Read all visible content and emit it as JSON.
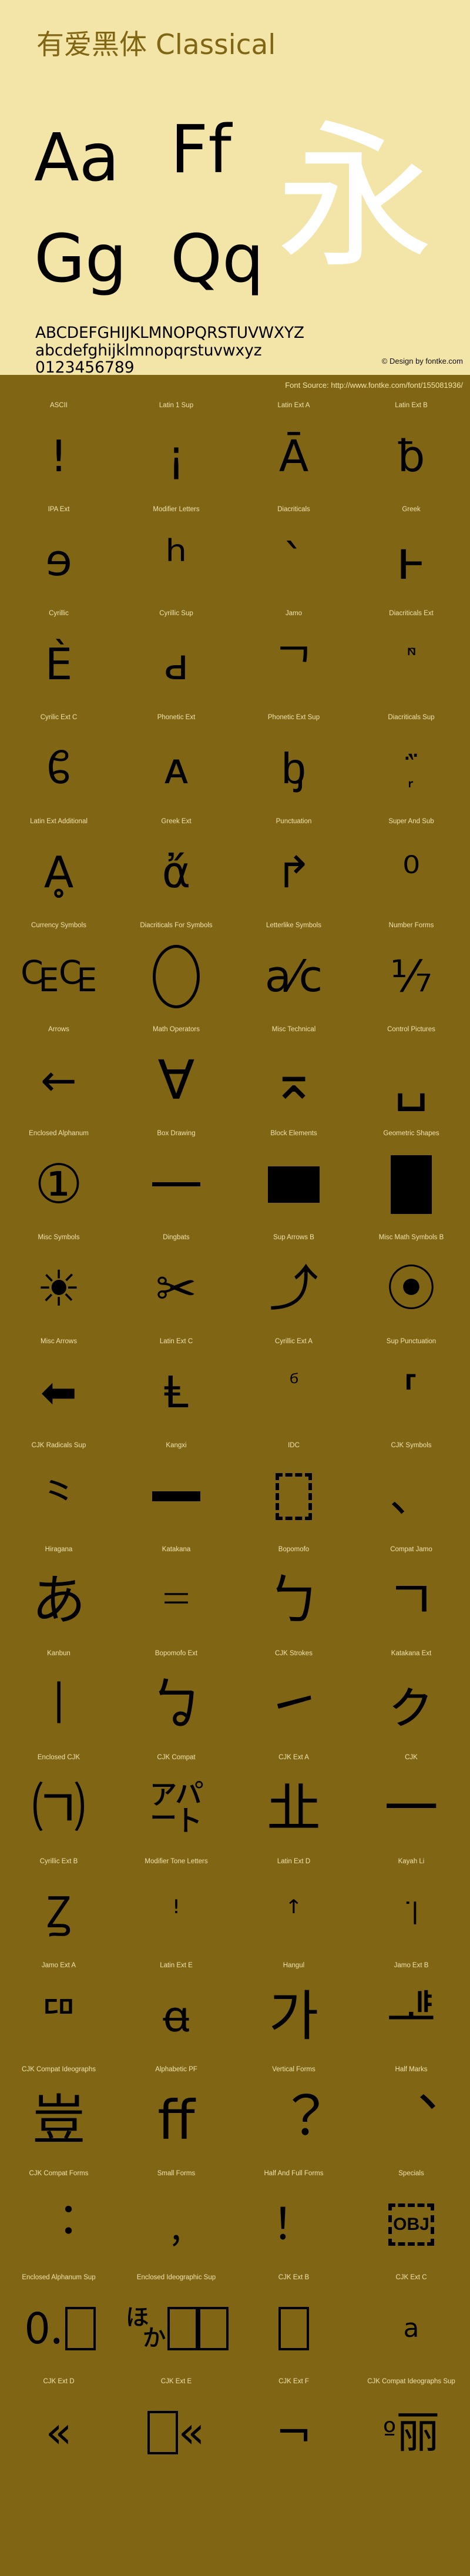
{
  "header": {
    "font_title": "有爱黑体 Classical",
    "samples": {
      "aa": "Aa",
      "ff": "Ff",
      "gg": "Gg",
      "qq": "Qq",
      "cjk": "永"
    },
    "alphabet_upper": "ABCDEFGHIJKLMNOPQRSTUVWXYZ",
    "alphabet_lower": "abcdefghijklmnopqrstuvwxyz",
    "digits": "0123456789",
    "credit": "© Design by fontke.com"
  },
  "source_bar": {
    "font_source": "Font Source: http://www.fontke.com/font/155081936/"
  },
  "colors": {
    "cream": "#F3E4A7",
    "olive": "#806614",
    "title": "#806614",
    "glyph": "#000000",
    "label": "#EFE2AE",
    "white_glyph": "#FFFFFF"
  },
  "glyph_grid": {
    "columns": 4,
    "rows": [
      [
        {
          "label": "ASCII",
          "glyph": "!",
          "style": "text"
        },
        {
          "label": "Latin 1 Sup",
          "glyph": "¡",
          "style": "text"
        },
        {
          "label": "Latin Ext A",
          "glyph": "Ā",
          "style": "text"
        },
        {
          "label": "Latin Ext B",
          "glyph": "ƀ",
          "style": "text"
        }
      ],
      [
        {
          "label": "IPA Ext",
          "glyph": "ɘ",
          "style": "text"
        },
        {
          "label": "Modifier Letters",
          "glyph": "ʰ",
          "style": "big"
        },
        {
          "label": "Diacriticals",
          "glyph": "`",
          "style": "text"
        },
        {
          "label": "Greek",
          "glyph": "ͱ",
          "style": "big"
        }
      ],
      [
        {
          "label": "Cyrillic",
          "glyph": "Ѐ",
          "style": "text"
        },
        {
          "label": "Cyrillic Sup",
          "glyph": "ԁ",
          "style": "text"
        },
        {
          "label": "Jamo",
          "glyph": "ᄀ",
          "style": "text"
        },
        {
          "label": "Diacriticals Ext",
          "glyph": "ᷠᷡ",
          "style": "sm"
        }
      ],
      [
        {
          "label": "Cyrilic Ext C",
          "glyph": "ᲀ",
          "style": "text"
        },
        {
          "label": "Phonetic Ext",
          "glyph": "ᴀ",
          "style": "text"
        },
        {
          "label": "Phonetic Ext Sup",
          "glyph": "ᶀ",
          "style": "text"
        },
        {
          "label": "Diacriticals Sup",
          "glyph": "᷊᷀",
          "style": "sm"
        }
      ],
      [
        {
          "label": "Latin Ext Additional",
          "glyph": "Ḁ",
          "style": "text"
        },
        {
          "label": "Greek Ext",
          "glyph": "ἄ",
          "style": "text"
        },
        {
          "label": "Punctuation",
          "glyph": "↱",
          "style": "text"
        },
        {
          "label": "Super And Sub",
          "glyph": "⁰",
          "style": "text"
        }
      ],
      [
        {
          "label": "Currency Symbols",
          "glyph": "₠₠",
          "style": "text"
        },
        {
          "label": "Diacriticals For Symbols",
          "glyph": "",
          "style": "circle"
        },
        {
          "label": "Letterlike Symbols",
          "glyph": "a⁄c",
          "style": "text"
        },
        {
          "label": "Number Forms",
          "glyph": "⅐",
          "style": "text"
        }
      ],
      [
        {
          "label": "Arrows",
          "glyph": "←",
          "style": "text"
        },
        {
          "label": "Math Operators",
          "glyph": "∀",
          "style": "big"
        },
        {
          "label": "Misc Technical",
          "glyph": "⌅",
          "style": "big"
        },
        {
          "label": "Control Pictures",
          "glyph": "␣",
          "style": "big"
        }
      ],
      [
        {
          "label": "Enclosed Alphanum",
          "glyph": "①",
          "style": "big"
        },
        {
          "label": "Box Drawing",
          "glyph": "",
          "style": "line"
        },
        {
          "label": "Block Elements",
          "glyph": "",
          "style": "rect"
        },
        {
          "label": "Geometric Shapes",
          "glyph": "",
          "style": "rect-tall"
        }
      ],
      [
        {
          "label": "Misc Symbols",
          "glyph": "☀",
          "style": "sun"
        },
        {
          "label": "Dingbats",
          "glyph": "✂",
          "style": "sun"
        },
        {
          "label": "Sup Arrows B",
          "glyph": "⤴",
          "style": "sun"
        },
        {
          "label": "Misc Math Symbols B",
          "glyph": "⦿",
          "style": "sun"
        }
      ],
      [
        {
          "label": "Misc Arrows",
          "glyph": "⬅",
          "style": "text"
        },
        {
          "label": "Latin Ext C",
          "glyph": "Ⱡ",
          "style": "text"
        },
        {
          "label": "Cyrillic Ext A",
          "glyph": "ⷠ",
          "style": "sm"
        },
        {
          "label": "Sup Punctuation",
          "glyph": "⸢",
          "style": "text"
        }
      ],
      [
        {
          "label": "CJK Radicals Sup",
          "glyph": "⺀",
          "style": "text"
        },
        {
          "label": "Kangxi",
          "glyph": "⼀",
          "style": "thickline"
        },
        {
          "label": "IDC",
          "glyph": "",
          "style": "dashed"
        },
        {
          "label": "CJK Symbols",
          "glyph": "、",
          "style": "text"
        }
      ],
      [
        {
          "label": "Hiragana",
          "glyph": "あ",
          "style": "big"
        },
        {
          "label": "Katakana",
          "glyph": "゠",
          "style": "big"
        },
        {
          "label": "Bopomofo",
          "glyph": "ㄅ",
          "style": "big"
        },
        {
          "label": "Compat Jamo",
          "glyph": "ㄱ",
          "style": "big"
        }
      ],
      [
        {
          "label": "Kanbun",
          "glyph": "㆐",
          "style": "big"
        },
        {
          "label": "Bopomofo Ext",
          "glyph": "ㆠ",
          "style": "big"
        },
        {
          "label": "CJK Strokes",
          "glyph": "㇀",
          "style": "big"
        },
        {
          "label": "Katakana Ext",
          "glyph": "ㇰ",
          "style": "big"
        }
      ],
      [
        {
          "label": "Enclosed CJK",
          "glyph": "㈀",
          "style": "big"
        },
        {
          "label": "CJK Compat",
          "glyph": "㌀",
          "style": "big"
        },
        {
          "label": "CJK Ext A",
          "glyph": "㐀",
          "style": "big"
        },
        {
          "label": "CJK",
          "glyph": "一",
          "style": "big"
        }
      ],
      [
        {
          "label": "Cyrillic Ext B",
          "glyph": "Ꙁ",
          "style": "text"
        },
        {
          "label": "Modifier Tone Letters",
          "glyph": "ꜝ",
          "style": "sm"
        },
        {
          "label": "Latin Ext D",
          "glyph": "ꜛ",
          "style": "sm"
        },
        {
          "label": "Kayah Li",
          "glyph": "꜈",
          "style": "sm"
        }
      ],
      [
        {
          "label": "Jamo Ext A",
          "glyph": "ꥠ",
          "style": "text"
        },
        {
          "label": "Latin Ext E",
          "glyph": "ꬰ",
          "style": "text"
        },
        {
          "label": "Hangul",
          "glyph": "가",
          "style": "big"
        },
        {
          "label": "Jamo Ext B",
          "glyph": "ힽ",
          "style": "big"
        }
      ],
      [
        {
          "label": "CJK Compat Ideographs",
          "glyph": "豈",
          "style": "big"
        },
        {
          "label": "Alphabetic PF",
          "glyph": "ff",
          "style": "big"
        },
        {
          "label": "Vertical Forms",
          "glyph": "︖",
          "style": "big"
        },
        {
          "label": "Half Marks",
          "glyph": "︑",
          "style": "big"
        }
      ],
      [
        {
          "label": "CJK Compat Forms",
          "glyph": "︓",
          "style": "text"
        },
        {
          "label": "Small Forms",
          "glyph": "﹐",
          "style": "text"
        },
        {
          "label": "Half And Full Forms",
          "glyph": "！",
          "style": "text"
        },
        {
          "label": "Specials",
          "glyph": "OBJ",
          "style": "obj"
        }
      ],
      [
        {
          "label": "Enclosed Alphanum Sup",
          "glyph": "🄀",
          "style": "pair"
        },
        {
          "label": "Enclosed Ideographic Sup",
          "glyph": "🈀",
          "style": "pair3"
        },
        {
          "label": "CJK Ext B",
          "glyph": "𠀀",
          "style": "pair"
        },
        {
          "label": "CJK Ext C",
          "glyph": "𪜀",
          "style": "paira"
        }
      ],
      [
        {
          "label": "CJK Ext D",
          "glyph": "𫝀",
          "style": "pairw"
        },
        {
          "label": "CJK Ext E",
          "glyph": "𫠠",
          "style": "pairbw"
        },
        {
          "label": "CJK Ext F",
          "glyph": "𬺯",
          "style": "pairn"
        },
        {
          "label": "CJK Compat Ideographs Sup",
          "glyph": "丽",
          "style": "pairo"
        }
      ]
    ]
  }
}
